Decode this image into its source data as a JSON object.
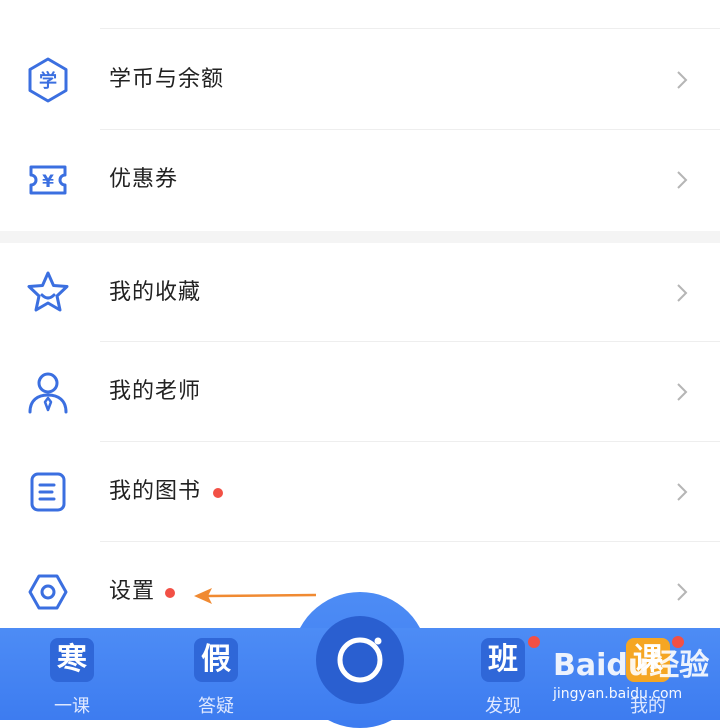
{
  "menu_group_1": [
    {
      "label": "学币与余额",
      "icon": "coin-hexagon-icon"
    },
    {
      "label": "优惠券",
      "icon": "coupon-icon"
    }
  ],
  "menu_group_2": [
    {
      "label": "我的收藏",
      "icon": "star-icon",
      "dot": false
    },
    {
      "label": "我的老师",
      "icon": "teacher-icon",
      "dot": false
    },
    {
      "label": "我的图书",
      "icon": "book-icon",
      "dot": true
    },
    {
      "label": "设置",
      "icon": "settings-hexagon-icon",
      "dot": true
    }
  ],
  "coin_icon_text": "学",
  "coupon_icon_text": "¥",
  "tabbar": {
    "tabs": [
      {
        "tile": "寒",
        "label": "一课",
        "badge": false
      },
      {
        "tile": "假",
        "label": "答疑",
        "badge": false
      },
      {
        "tile": "班",
        "label": "发现",
        "badge": true
      },
      {
        "tile": "课",
        "label": "我的",
        "badge": true
      }
    ],
    "center_icon": "camera-icon"
  },
  "watermark": {
    "logo": "Baidu经验",
    "url": "jingyan.baidu.com"
  },
  "colors": {
    "accent": "#4d8cf5",
    "icon_blue": "#3b6fe0",
    "dot_red": "#f25045",
    "arrow_orange": "#f08a32",
    "tabbar": "#4d8cf5"
  }
}
